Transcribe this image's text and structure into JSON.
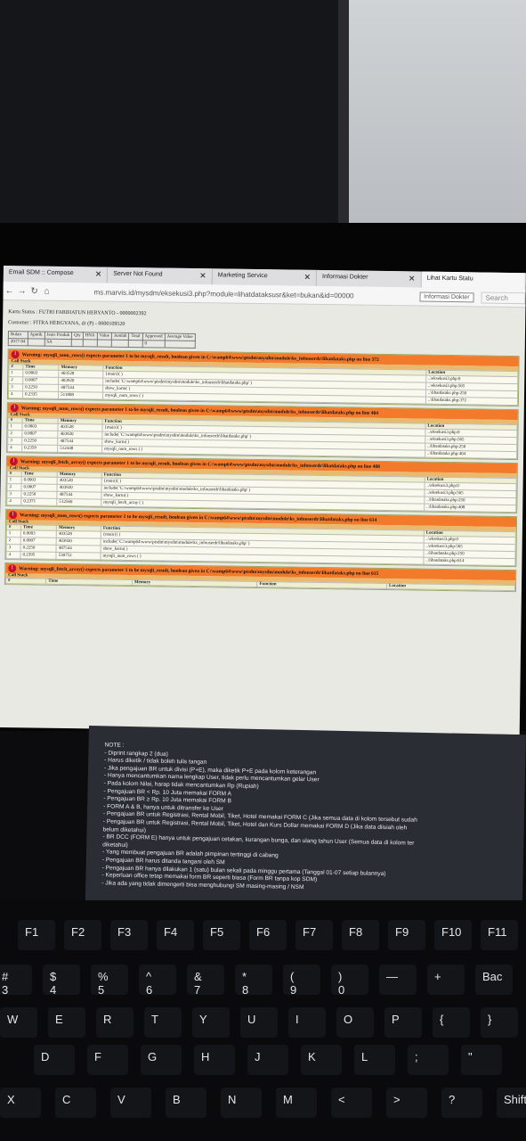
{
  "browser": {
    "tabs": [
      {
        "label": "Email SDM :: Compose"
      },
      {
        "label": "Server Not Found"
      },
      {
        "label": "Marketing Service"
      },
      {
        "label": "Informasi Dokter"
      },
      {
        "label": "Lihat Kartu Statu"
      }
    ],
    "close_glyph": "✕",
    "url": "ms.marvis.id/mysdm/eksekusi3.php?module=lihatdataksusr&ket=bukan&id=00000",
    "url_suggest": "Informasi Dokter",
    "search_placeholder": "Search"
  },
  "page": {
    "kartu_status": "Kartu Status : FUTRI FARIHATUN HERYANTO - 0000002392",
    "customer": "Customer : FITRA HERGYANA, dr (P) - 0000109520",
    "table_headers": [
      "Bulan",
      "Apotik",
      "Jenis Produk",
      "Qty",
      "HNA",
      "Value",
      "Jumlah",
      "Total",
      "Approved",
      "Average Value"
    ],
    "table_values": [
      "2017-04",
      "",
      "SA",
      "",
      "",
      "",
      "",
      "",
      "0",
      ""
    ]
  },
  "errors": [
    {
      "message": "Warning: mysqli_num_rows() expects parameter 1 to be mysqli_result, boolean given in C:\\wamp64\\www\\ptsdm\\mysdm\\module\\ks_infouserdr\\lihatdataks.php on line 372",
      "rows": [
        {
          "n": "1",
          "time": "0.0003",
          "mem": "403528",
          "func": "{main}( )",
          "loc": "..\\eksekusi3.php:0"
        },
        {
          "n": "2",
          "time": "0.0007",
          "mem": "403920",
          "func": "include( 'C:\\wamp64\\www\\ptsdm\\mysdm\\module\\ks_infouserdr\\lihatdataks.php' )",
          "loc": "..\\eksekusi3.php:565"
        },
        {
          "n": "3",
          "time": "0.2250",
          "mem": "487544",
          "func": "show_kartu( )",
          "loc": "..\\lihatdataks.php:250"
        },
        {
          "n": "4",
          "time": "0.2335",
          "mem": "511808",
          "func": "mysqli_num_rows ( )",
          "loc": "..\\lihatdataks.php:372"
        }
      ]
    },
    {
      "message": "Warning: mysqli_num_rows() expects parameter 1 to be mysqli_result, boolean given in C:\\wamp64\\www\\ptsdm\\mysdm\\module\\ks_infouserdr\\lihatdataks.php on line 404",
      "rows": [
        {
          "n": "1",
          "time": "0.0003",
          "mem": "403528",
          "func": "{main}( )",
          "loc": "..\\eksekusi3.php:0"
        },
        {
          "n": "2",
          "time": "0.0007",
          "mem": "403920",
          "func": "include( 'C:\\wamp64\\www\\ptsdm\\mysdm\\module\\ks_infouserdr\\lihatdataks.php' )",
          "loc": "..\\eksekusi3.php:565"
        },
        {
          "n": "3",
          "time": "0.2250",
          "mem": "487544",
          "func": "show_kartu( )",
          "loc": "..\\lihatdataks.php:250"
        },
        {
          "n": "4",
          "time": "0.2359",
          "mem": "512448",
          "func": "mysqli_num_rows ( )",
          "loc": "..\\lihatdataks.php:404"
        }
      ]
    },
    {
      "message": "Warning: mysqli_fetch_array() expects parameter 1 to be mysqli_result, boolean given in C:\\wamp64\\www\\ptsdm\\mysdm\\module\\ks_infouserdr\\lihatdataks.php on line 408",
      "rows": [
        {
          "n": "1",
          "time": "0.0003",
          "mem": "403528",
          "func": "{main}( )",
          "loc": "..\\eksekusi3.php:0"
        },
        {
          "n": "2",
          "time": "0.0007",
          "mem": "403920",
          "func": "include( 'C:\\wamp64\\www\\ptsdm\\mysdm\\module\\ks_infouserdr\\lihatdataks.php' )",
          "loc": "..\\eksekusi3.php:565"
        },
        {
          "n": "3",
          "time": "0.2250",
          "mem": "487544",
          "func": "show_kartu( )",
          "loc": "..\\lihatdataks.php:250"
        },
        {
          "n": "4",
          "time": "0.2371",
          "mem": "512560",
          "func": "mysqli_fetch_array ( )",
          "loc": "..\\lihatdataks.php:408"
        }
      ]
    },
    {
      "message": "Warning: mysqli_num_rows() expects parameter 1 to be mysqli_result, boolean given in C:\\wamp64\\www\\ptsdm\\mysdm\\module\\ks_infouserdr\\lihatdataks.php on line 614",
      "rows": [
        {
          "n": "1",
          "time": "0.0003",
          "mem": "403528",
          "func": "{main}( )",
          "loc": "..\\eksekusi3.php:0"
        },
        {
          "n": "2",
          "time": "0.0007",
          "mem": "403920",
          "func": "include( 'C:\\wamp64\\www\\ptsdm\\mysdm\\module\\ks_infouserdr\\lihatdataks.php' )",
          "loc": "..\\eksekusi3.php:565"
        },
        {
          "n": "3",
          "time": "0.2250",
          "mem": "487544",
          "func": "show_kartu( )",
          "loc": "..\\lihatdataks.php:250"
        },
        {
          "n": "4",
          "time": "0.2395",
          "mem": "530752",
          "func": "mysqli_num_rows ( )",
          "loc": "..\\lihatdataks.php:614"
        }
      ]
    },
    {
      "message": "Warning: mysqli_fetch_array() expects parameter 1 to be mysqli_result, boolean given in C:\\wamp64\\www\\ptsdm\\mysdm\\module\\ks_infouserdr\\lihatdataks.php on line 615",
      "rows": []
    }
  ],
  "stack_labels": {
    "call_stack": "Call Stack",
    "n": "#",
    "time": "Time",
    "memory": "Memory",
    "function": "Function",
    "location": "Location"
  },
  "note_lines": [
    "NOTE :",
    "- Diprint rangkap 2 (dua)",
    "- Harus diketik / tidak boleh tulis tangan",
    "- Jika pengajuan BR untuk divisi (P+E), maka diketik P+E pada kolom keterangan",
    "- Hanya mencantumkan nama lengkap User, tidak perlu mencantumkan gelar User",
    "- Pada kolom Nilai, harap tidak mencantumkan Rp (Rupiah)",
    "- Pengajuan BR < Rp. 10 Juta memakai FORM A",
    "- Pengajuan BR ≥ Rp. 10 Juta memakai FORM B",
    "- FORM A & B, hanya untuk ditransfer ke User",
    "- Pengajuan BR untuk Registrasi, Rental Mobil, Tiket, Hotel memakai FORM C (Jika semua data di kolom tersebut sudah",
    "- Pengajuan BR untuk Registrasi, Rental Mobil, Tiket, Hotel dan Kurs Dollar memakai FORM D (Jika data diisiah oleh",
    "belum diketahui)",
    "- BR DCC (FORM E) hanya untuk pengajuan cetakan, kurangan bunga, dan ulang tahun User (Semua data di kolom ter",
    "diketahui)",
    "- Yang membuat pengajuan BR adalah pimpinan tertinggi di cabang",
    "- Pengajuan BR harus ditanda tangani oleh SM",
    "- Pengajuan BR hanya dilakukan 1 (satu) bulan sekali pada minggu pertama (Tanggal 01-07 setiap bulannya)",
    "- Keperluan office tetap memakai form BR seperti biasa (Form BR tanpa kop SDM)",
    "- Jika ada yang tidak dimengerti bisa menghubungi SM masing-masing / NSM"
  ],
  "keyboard": {
    "fn_row": [
      "F1",
      "F2",
      "F3",
      "F4",
      "F5",
      "F6",
      "F7",
      "F8",
      "F9",
      "F10",
      "F11"
    ],
    "num_row": [
      "#\n3",
      "$\n4",
      "%\n5",
      "^\n6",
      "&\n7",
      "*\n8",
      "(\n9",
      ")\n0",
      "—",
      "+",
      "Bac"
    ],
    "row_q": [
      "W",
      "E",
      "R",
      "T",
      "Y",
      "U",
      "I",
      "O",
      "P",
      "{",
      "}"
    ],
    "row_a": [
      "D",
      "F",
      "G",
      "H",
      "J",
      "K",
      "L",
      ";",
      "\""
    ],
    "row_z": [
      "X",
      "C",
      "V",
      "B",
      "N",
      "M",
      "<",
      ">",
      "?",
      "Shift"
    ]
  },
  "taskbar_icons": [
    "chrome-icon",
    "firefox-icon",
    "files-icon",
    "s-app-icon",
    "chrome2-icon",
    "word-icon",
    "ie-icon",
    "media-icon",
    "opera-icon",
    "mi-icon",
    "hp-icon"
  ]
}
